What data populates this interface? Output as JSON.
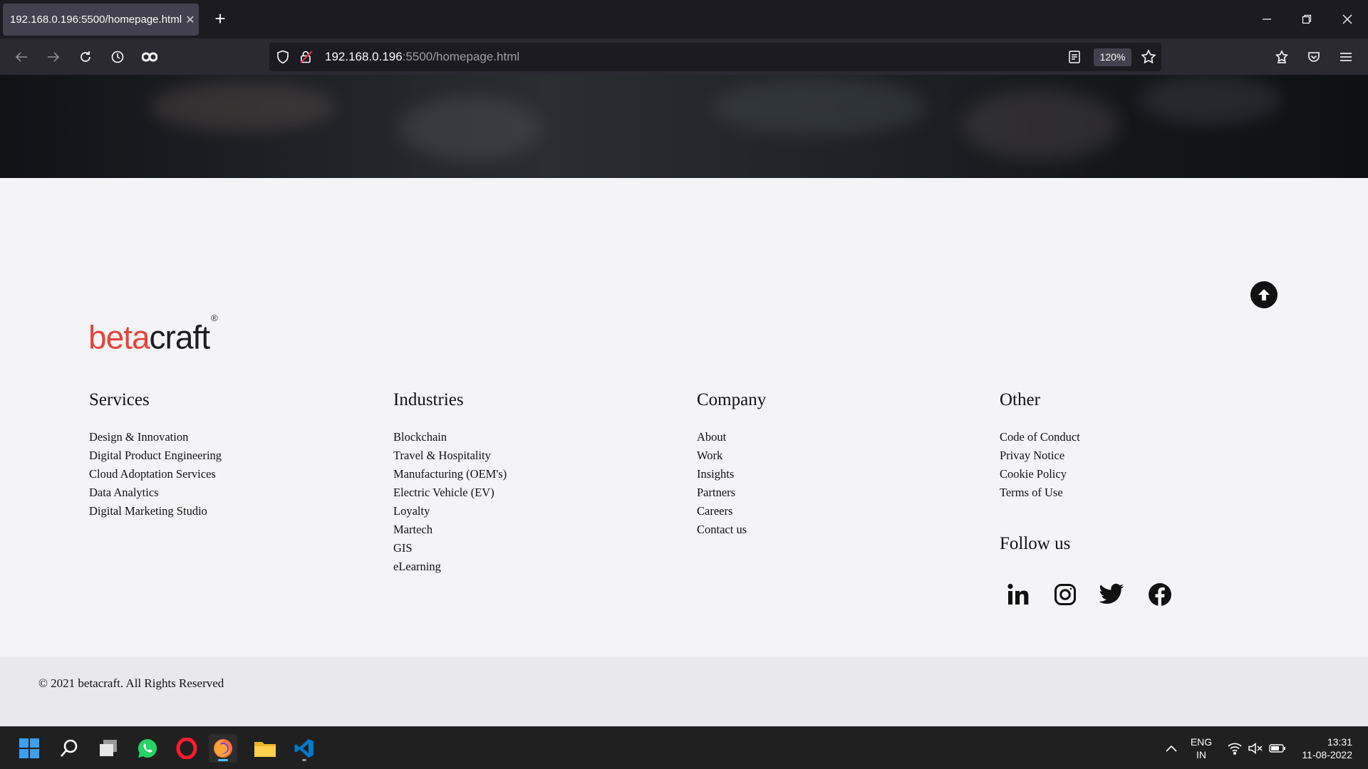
{
  "browser": {
    "tab_title": "192.168.0.196:5500/homepage.html",
    "url_host": "192.168.0.196",
    "url_path": ":5500/homepage.html",
    "zoom": "120%"
  },
  "footer": {
    "logo": {
      "part1": "beta",
      "part2": "craft",
      "mark": "®"
    },
    "columns": [
      {
        "title": "Services",
        "items": [
          "Design & Innovation",
          "Digital Product Engineering",
          "Cloud Adoptation Services",
          "Data Analytics",
          "Digital Marketing Studio"
        ]
      },
      {
        "title": "Industries",
        "items": [
          "Blockchain",
          "Travel & Hospitality",
          "Manufacturing (OEM's)",
          "Electric Vehicle (EV)",
          "Loyalty",
          "Martech",
          "GIS",
          "eLearning"
        ]
      },
      {
        "title": "Company",
        "items": [
          "About",
          "Work",
          "Insights",
          "Partners",
          "Careers",
          "Contact us"
        ]
      },
      {
        "title": "Other",
        "items": [
          "Code of Conduct",
          "Privay Notice",
          "Cookie Policy",
          "Terms of Use"
        ]
      }
    ],
    "follow_title": "Follow us",
    "social_icons": [
      "linkedin-icon",
      "instagram-icon",
      "twitter-icon",
      "facebook-icon"
    ],
    "copyright": "© 2021 betacraft. All Rights Reserved"
  },
  "taskbar": {
    "apps": [
      "start",
      "search",
      "task-view",
      "whatsapp",
      "opera",
      "firefox",
      "file-explorer",
      "vscode"
    ],
    "lang_line1": "ENG",
    "lang_line2": "IN",
    "time": "13:31",
    "date": "11-08-2022"
  },
  "colors": {
    "brand_red": "#e2463b",
    "firefox_tab": "#42414d",
    "taskbar_accent": "#4cc2ff"
  }
}
